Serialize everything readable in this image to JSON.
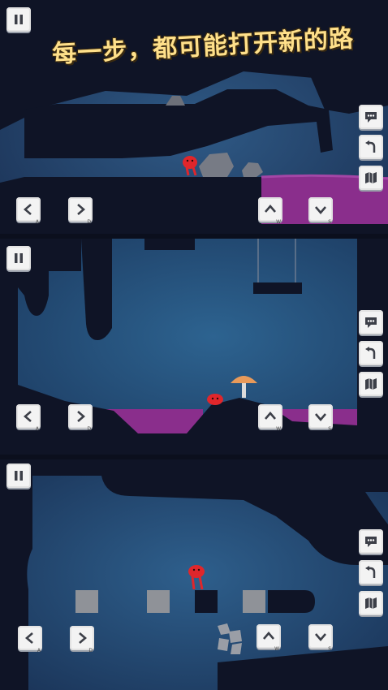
{
  "headline": "每一步，都可能打开新的路",
  "controls": {
    "left_key": "A",
    "right_key": "D",
    "up_key": "W",
    "down_key": "S"
  },
  "icons": {
    "pause": "pause-icon",
    "chat": "chat-bubble-icon",
    "undo": "undo-arrow-icon",
    "map": "map-icon",
    "left": "arrow-left-icon",
    "right": "arrow-right-icon",
    "up": "arrow-up-icon",
    "down": "arrow-down-icon"
  },
  "colors": {
    "background": "#27476e",
    "rock": "#0f1426",
    "poison": "#8a2e8c",
    "player": "#e0262b",
    "mushroom": "#e89a5a",
    "headline": "#ffe08a"
  }
}
